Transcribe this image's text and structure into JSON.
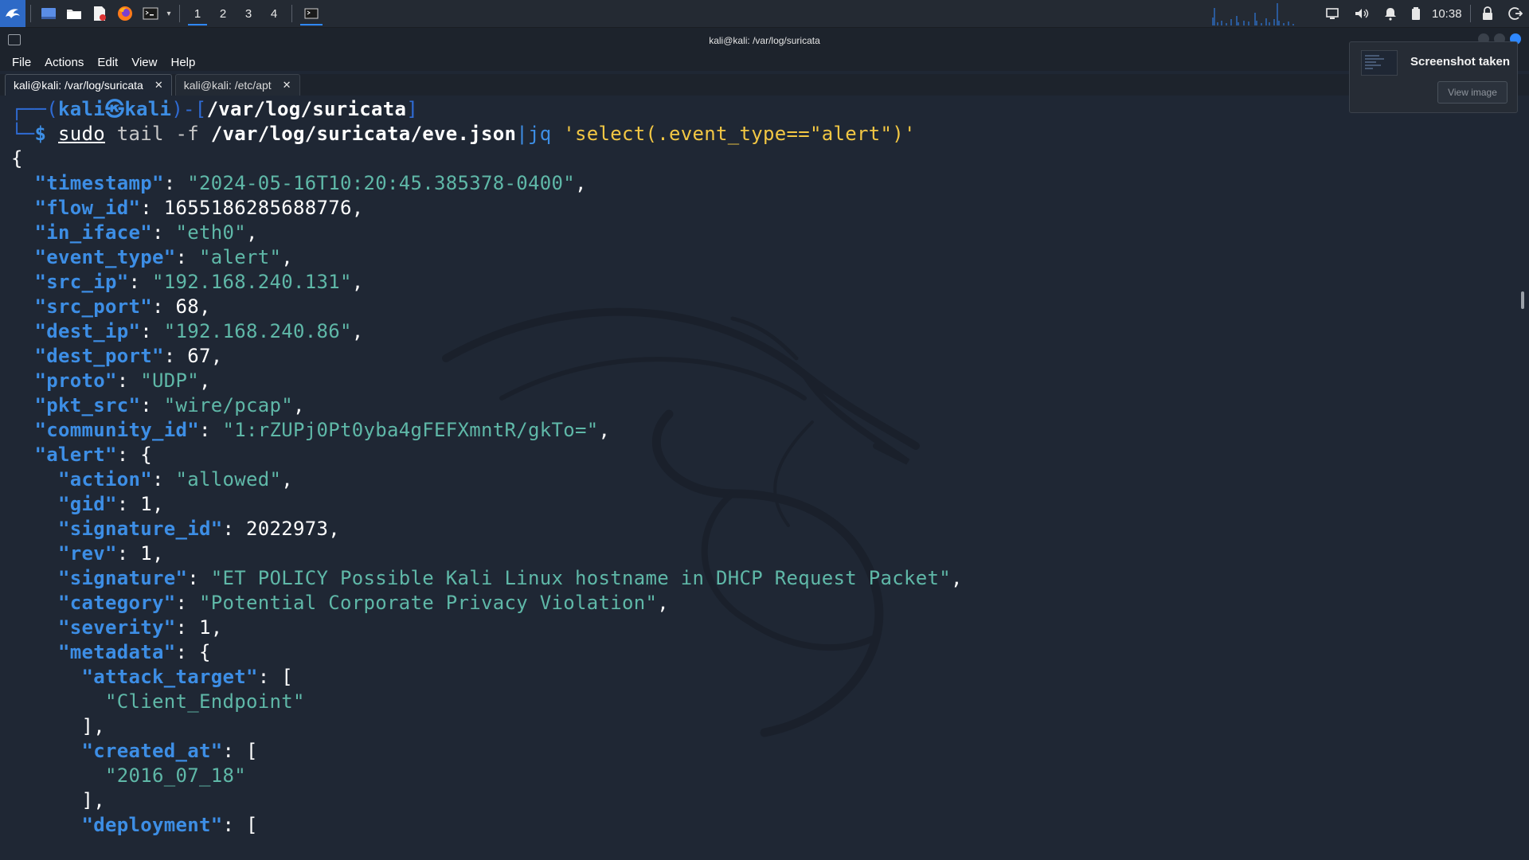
{
  "panel": {
    "workspaces": [
      "1",
      "2",
      "3",
      "4"
    ],
    "active_workspace": "1",
    "clock": "10:38",
    "accent": "#2f88ff"
  },
  "window": {
    "title": "kali@kali: /var/log/suricata"
  },
  "menu": [
    "File",
    "Actions",
    "Edit",
    "View",
    "Help"
  ],
  "tabs": [
    {
      "label": "kali@kali: /var/log/suricata",
      "active": true
    },
    {
      "label": "kali@kali: /etc/apt",
      "active": false
    }
  ],
  "prompt": {
    "user": "kali",
    "host": "kali",
    "cwd": "/var/log/suricata",
    "command": {
      "sudo": "sudo",
      "tail": "tail",
      "flag": "-f",
      "file": "/var/log/suricata/eve.json",
      "pipe": "|",
      "jq": "jq",
      "filter": "'select(.event_type==\"alert\")'"
    }
  },
  "output": {
    "timestamp": "2024-05-16T10:20:45.385378-0400",
    "flow_id": "1655186285688776",
    "in_iface": "eth0",
    "event_type": "alert",
    "src_ip": "192.168.240.131",
    "src_port": "68",
    "dest_ip": "192.168.240.86",
    "dest_port": "67",
    "proto": "UDP",
    "pkt_src": "wire/pcap",
    "community_id": "1:rZUPj0Pt0yba4gFEFXmntR/gkTo=",
    "alert": {
      "action": "allowed",
      "gid": "1",
      "signature_id": "2022973",
      "rev": "1",
      "signature": "ET POLICY Possible Kali Linux hostname in DHCP Request Packet",
      "category": "Potential Corporate Privacy Violation",
      "severity": "1",
      "metadata": {
        "attack_target": "Client_Endpoint",
        "created_at": "2016_07_18"
      }
    }
  },
  "notification": {
    "title": "Screenshot taken",
    "button": "View image"
  }
}
